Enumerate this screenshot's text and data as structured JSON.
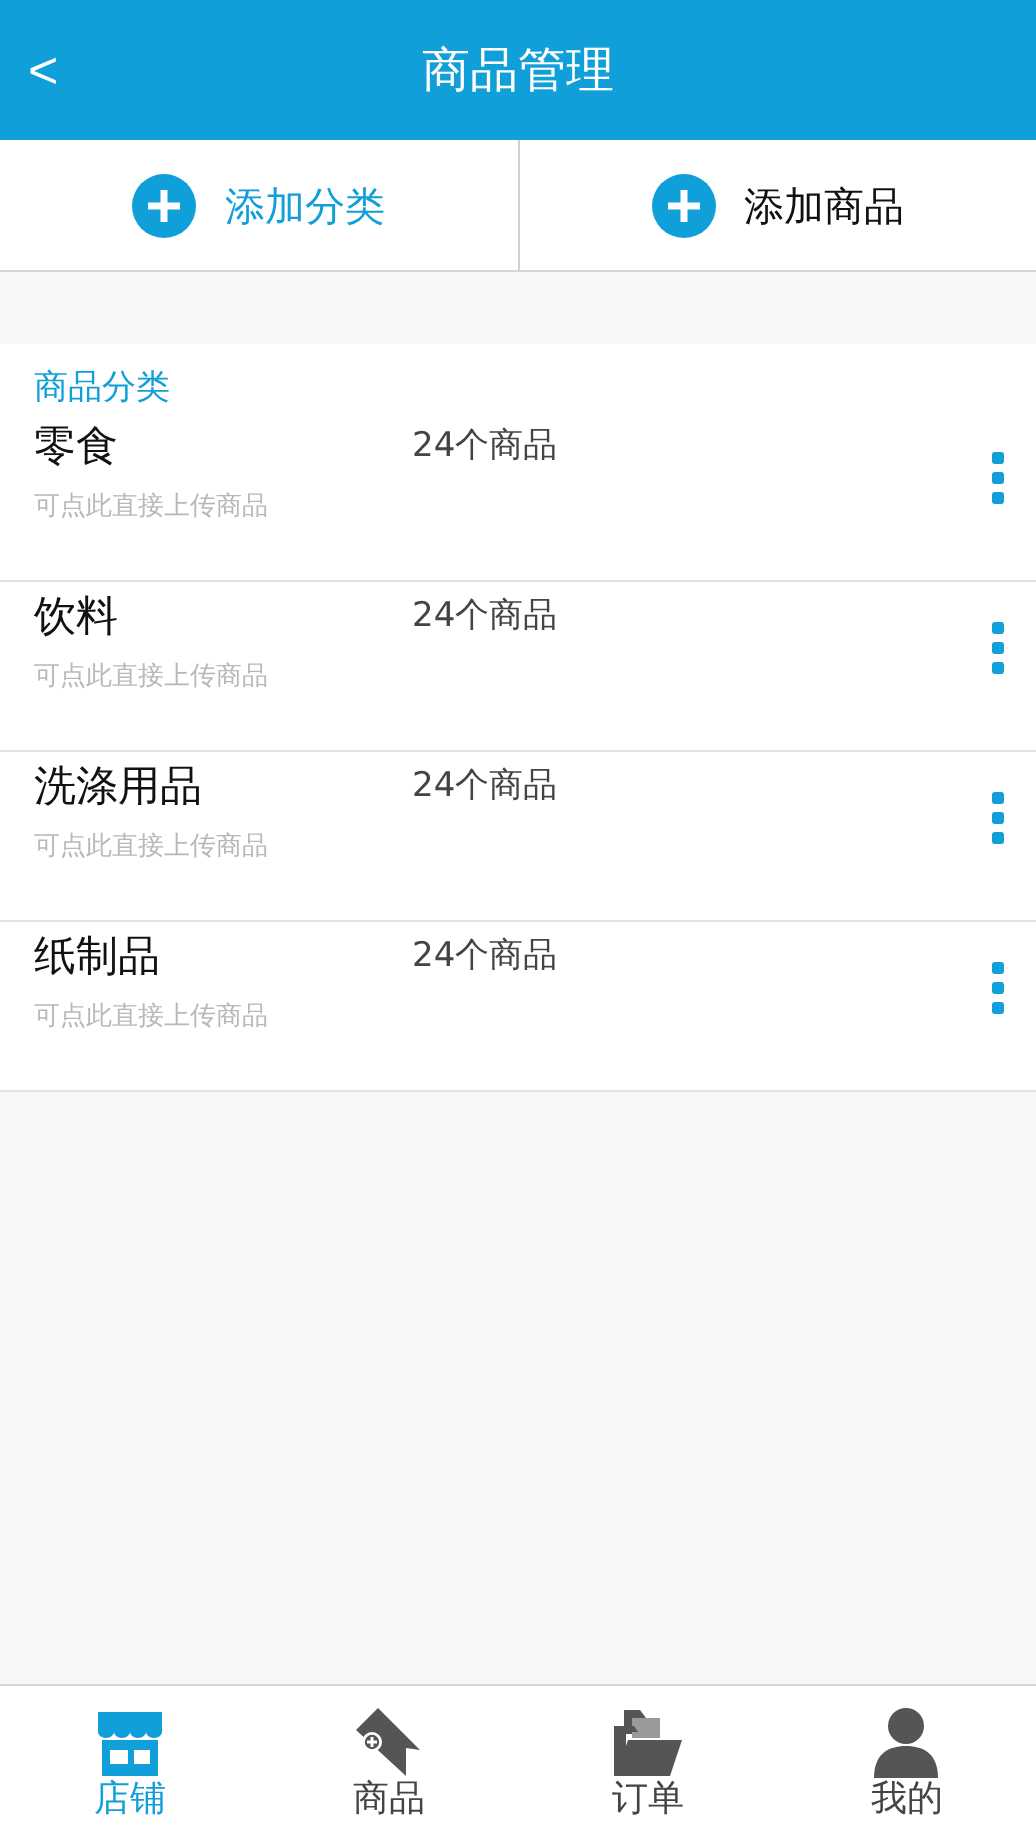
{
  "header": {
    "back": "<",
    "title": "商品管理"
  },
  "actions": [
    {
      "label": "添加分类",
      "selected": true
    },
    {
      "label": "添加商品",
      "selected": false
    }
  ],
  "section_title": "商品分类",
  "categories": [
    {
      "name": "零食",
      "count": "24个商品",
      "hint": "可点此直接上传商品"
    },
    {
      "name": "饮料",
      "count": "24个商品",
      "hint": "可点此直接上传商品"
    },
    {
      "name": "洗涤用品",
      "count": "24个商品",
      "hint": "可点此直接上传商品"
    },
    {
      "name": "纸制品",
      "count": "24个商品",
      "hint": "可点此直接上传商品"
    }
  ],
  "tabs": [
    {
      "label": "店铺",
      "selected": true
    },
    {
      "label": "商品",
      "selected": false
    },
    {
      "label": "订单",
      "selected": false
    },
    {
      "label": "我的",
      "selected": false
    }
  ]
}
